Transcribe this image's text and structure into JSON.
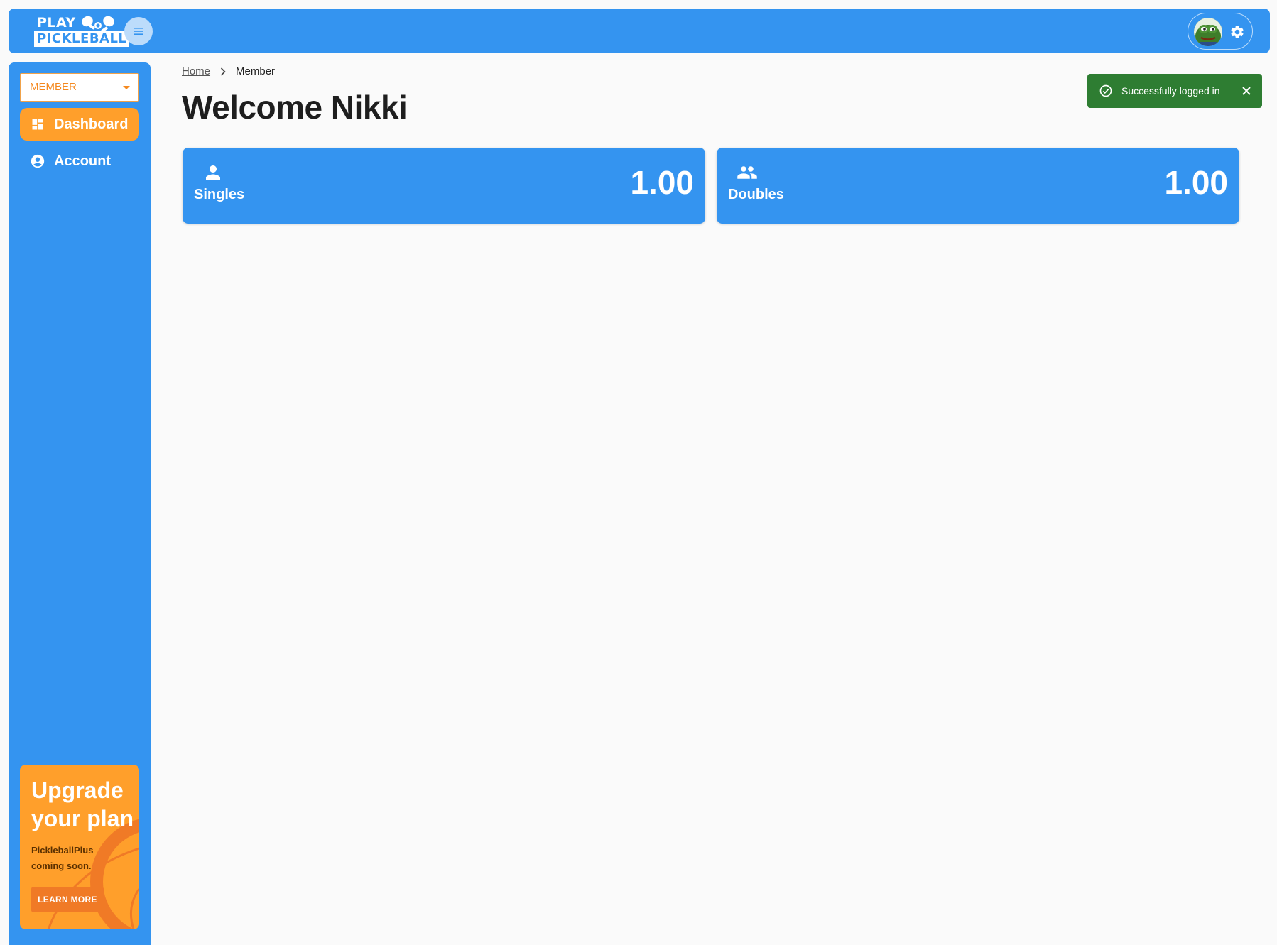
{
  "brand": {
    "line1": "PLAY",
    "line2": "PICKLEBALL"
  },
  "colors": {
    "primary": "#3494f0",
    "accent": "#ff9f2b",
    "success": "#2e7d32"
  },
  "sidebar": {
    "role_select": "MEMBER",
    "items": [
      {
        "label": "Dashboard",
        "icon": "dashboard-icon",
        "active": true
      },
      {
        "label": "Account",
        "icon": "account-circle-icon",
        "active": false
      }
    ],
    "upgrade": {
      "title": "Upgrade your plan",
      "description": "PickleballPlus coming soon.",
      "button": "LEARN MORE"
    }
  },
  "breadcrumb": {
    "home": "Home",
    "current": "Member"
  },
  "page": {
    "title": "Welcome Nikki"
  },
  "cards": [
    {
      "label": "Singles",
      "value": "1.00",
      "icon": "person-icon"
    },
    {
      "label": "Doubles",
      "value": "1.00",
      "icon": "people-icon"
    }
  ],
  "toast": {
    "message": "Successfully logged in"
  }
}
